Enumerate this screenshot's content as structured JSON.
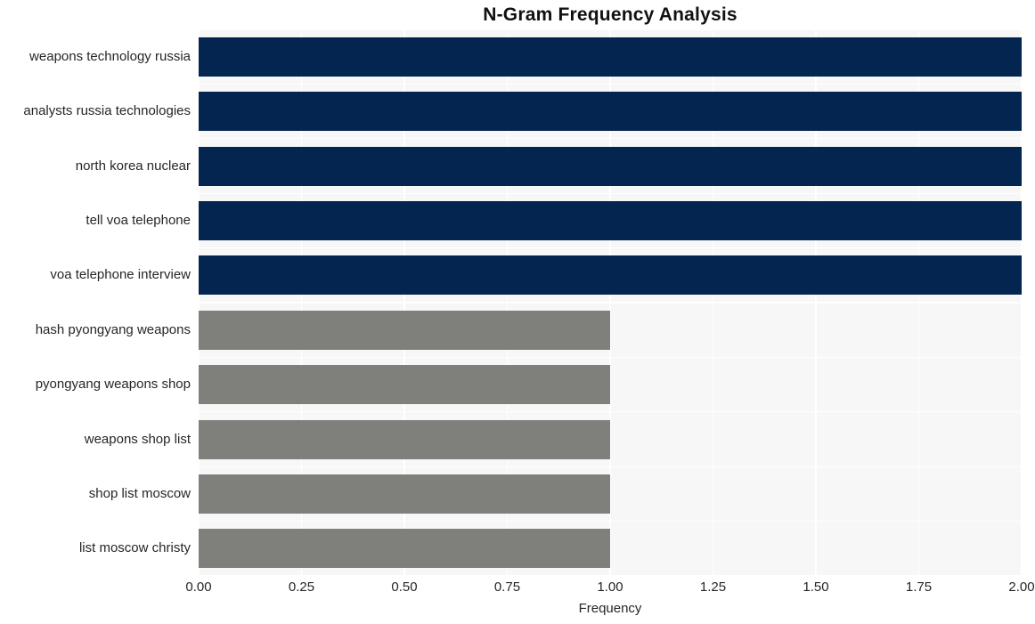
{
  "chart_data": {
    "type": "bar",
    "orientation": "horizontal",
    "title": "N-Gram Frequency Analysis",
    "xlabel": "Frequency",
    "ylabel": "",
    "categories": [
      "weapons technology russia",
      "analysts russia technologies",
      "north korea nuclear",
      "tell voa telephone",
      "voa telephone interview",
      "hash pyongyang weapons",
      "pyongyang weapons shop",
      "weapons shop list",
      "shop list moscow",
      "list moscow christy"
    ],
    "values": [
      2,
      2,
      2,
      2,
      2,
      1,
      1,
      1,
      1,
      1
    ],
    "bar_colors": [
      "#04254f",
      "#04254f",
      "#04254f",
      "#04254f",
      "#04254f",
      "#7f7f7c",
      "#7f7f7c",
      "#7f7f7c",
      "#7f7f7c",
      "#7f7f7c"
    ],
    "xlim": [
      0,
      2
    ],
    "xticks": [
      0,
      0.25,
      0.5,
      0.75,
      1,
      1.25,
      1.5,
      1.75,
      2
    ],
    "xtick_labels": [
      "0.00",
      "0.25",
      "0.50",
      "0.75",
      "1.00",
      "1.25",
      "1.50",
      "1.75",
      "2.00"
    ],
    "grid": true,
    "grid_color": "#ffffff",
    "plot_background": "#f7f7f7",
    "figure_background": "#ffffff",
    "legend": null
  },
  "colors": {
    "accent_navy": "#04254f",
    "accent_grey": "#7f7f7c",
    "text": "#262626",
    "title_text": "#111111"
  }
}
